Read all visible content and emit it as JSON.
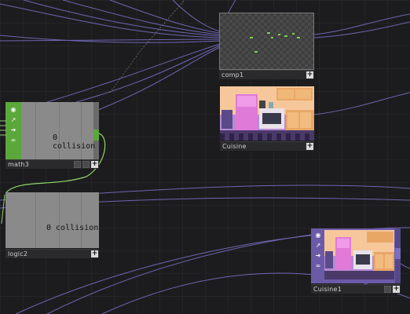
{
  "nodes": {
    "comp1": {
      "name": "comp1",
      "plus": "+"
    },
    "cuisine": {
      "name": "Cuisine",
      "plus": "+"
    },
    "math3": {
      "name": "math3",
      "value_label": "0 collision",
      "plus": "+"
    },
    "logic2": {
      "name": "logic2",
      "value_label": "0 collision",
      "plus": "+"
    },
    "cuisine1": {
      "name": "Cuisine1",
      "plus": "+"
    }
  },
  "colors": {
    "background": "#1c1c1e",
    "wire_purple": "#8a80d8",
    "wire_green": "#8fd66a",
    "chop_green": "#5aa83a",
    "top_purple": "#5a4a9a"
  },
  "icons": [
    "viewer-icon",
    "graph-icon",
    "arrow-icon",
    "link-icon"
  ]
}
